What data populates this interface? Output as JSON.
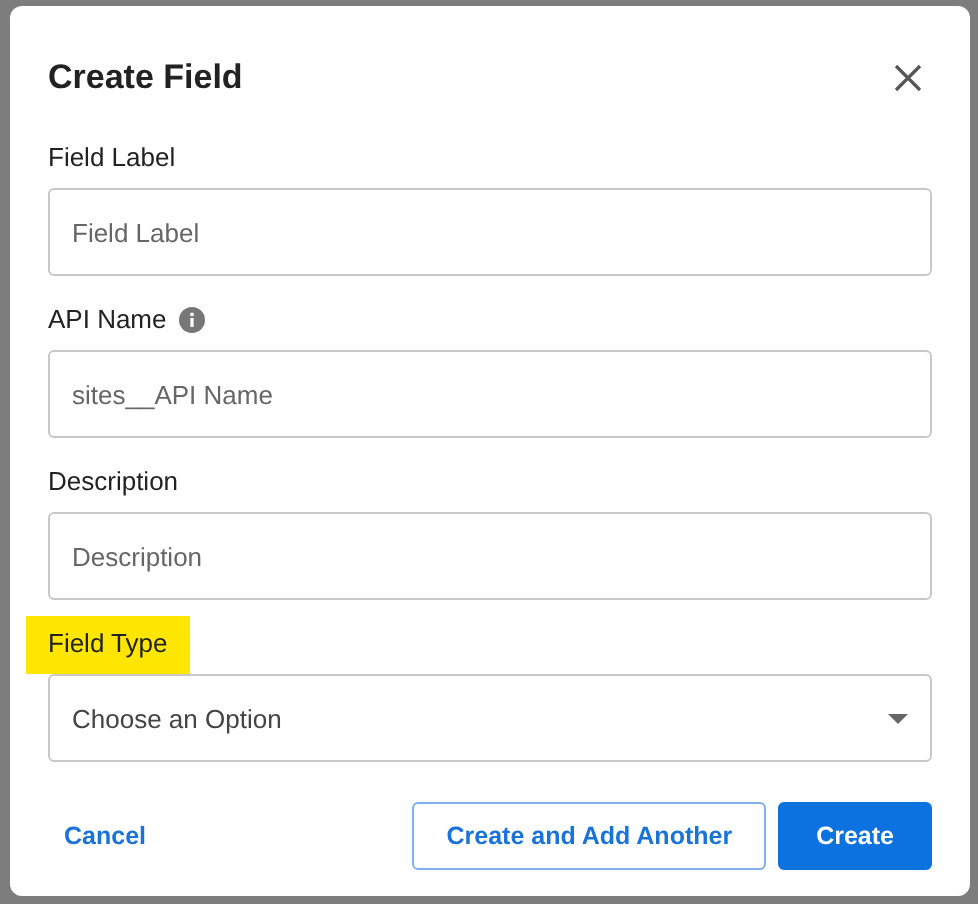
{
  "dialog": {
    "title": "Create Field",
    "fields": [
      {
        "kind": "text",
        "label": "Field Label",
        "placeholder": "Field Label",
        "info": false,
        "highlighted": false
      },
      {
        "kind": "text",
        "label": "API Name",
        "placeholder": "sites__API Name",
        "info": true,
        "highlighted": false
      },
      {
        "kind": "text",
        "label": "Description",
        "placeholder": "Description",
        "info": false,
        "highlighted": false
      },
      {
        "kind": "select",
        "label": "Field Type",
        "placeholder": "Choose an Option",
        "info": false,
        "highlighted": true
      }
    ],
    "buttons": [
      {
        "kind": "link",
        "label": "Cancel"
      },
      {
        "kind": "outline",
        "label": "Create and Add Another"
      },
      {
        "kind": "primary",
        "label": "Create"
      }
    ]
  }
}
